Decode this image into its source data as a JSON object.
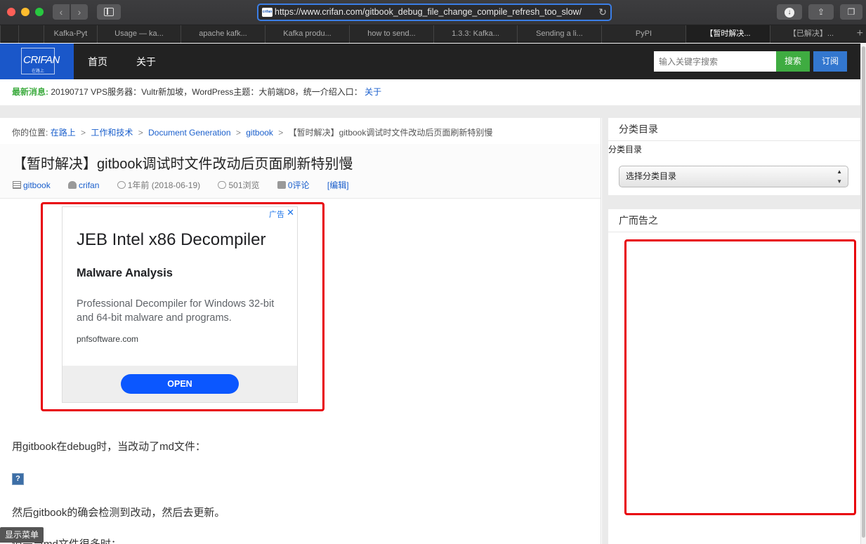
{
  "browser": {
    "url": "https://www.crifan.com/gitbook_debug_file_change_compile_refresh_too_slow/",
    "favicon_text": "crifan",
    "tabs": [
      {
        "label": "Kafka-Pyt"
      },
      {
        "label": "Usage — ka..."
      },
      {
        "label": "apache kafk..."
      },
      {
        "label": "Kafka produ..."
      },
      {
        "label": "how to send..."
      },
      {
        "label": "1.3.3: Kafka..."
      },
      {
        "label": "Sending a li..."
      },
      {
        "label": "PyPI"
      },
      {
        "label": "【暂时解决..."
      },
      {
        "label": "【已解决】..."
      }
    ],
    "new_tab": "+"
  },
  "header": {
    "logo_text": "CRIFAN",
    "logo_sub": "在路上",
    "nav": {
      "home": "首页",
      "about": "关于"
    },
    "search_placeholder": "输入关键字搜索",
    "search_button": "搜索",
    "subscribe_button": "订阅"
  },
  "news": {
    "label": "最新消息:",
    "text": "20190717 VPS服务器：Vultr新加坡，WordPress主题：大前端D8，统一介绍入口：",
    "link": "关于"
  },
  "breadcrumb": {
    "prefix": "你的位置:",
    "items": [
      "在路上",
      "工作和技术",
      "Document Generation",
      "gitbook"
    ],
    "separator": ">",
    "current": "【暂时解决】gitbook调试时文件改动后页面刷新特别慢"
  },
  "article": {
    "title": "【暂时解决】gitbook调试时文件改动后页面刷新特别慢",
    "meta": {
      "category": "gitbook",
      "author": "crifan",
      "date": "1年前 (2018-06-19)",
      "views": "501浏览",
      "comments": "0评论",
      "edit": "[编辑]"
    },
    "paragraphs": [
      "用gitbook在debug时，当改动了md文件：",
      "然后gitbook的确会检测到改动，然后去更新。",
      "但是当md文件很多时："
    ],
    "image_placeholder": "?"
  },
  "ad": {
    "label": "广告",
    "close": "✕",
    "title": "JEB Intel x86 Decompiler",
    "subtitle": "Malware Analysis",
    "description": "Professional Decompiler for Windows 32-bit and 64-bit malware and programs.",
    "domain": "pnfsoftware.com",
    "cta": "OPEN"
  },
  "sidebar": {
    "category_widget": {
      "title": "分类目录",
      "label": "分类目录",
      "select_value": "选择分类目录"
    },
    "ad_widget": {
      "title": "广而告之"
    }
  },
  "show_menu": "显示菜单",
  "colors": {
    "accent_blue": "#1a57c9",
    "search_green": "#3fac41",
    "link_blue": "#1a5fcc",
    "highlight_red": "#e8000a",
    "ad_button": "#0b57ff"
  }
}
